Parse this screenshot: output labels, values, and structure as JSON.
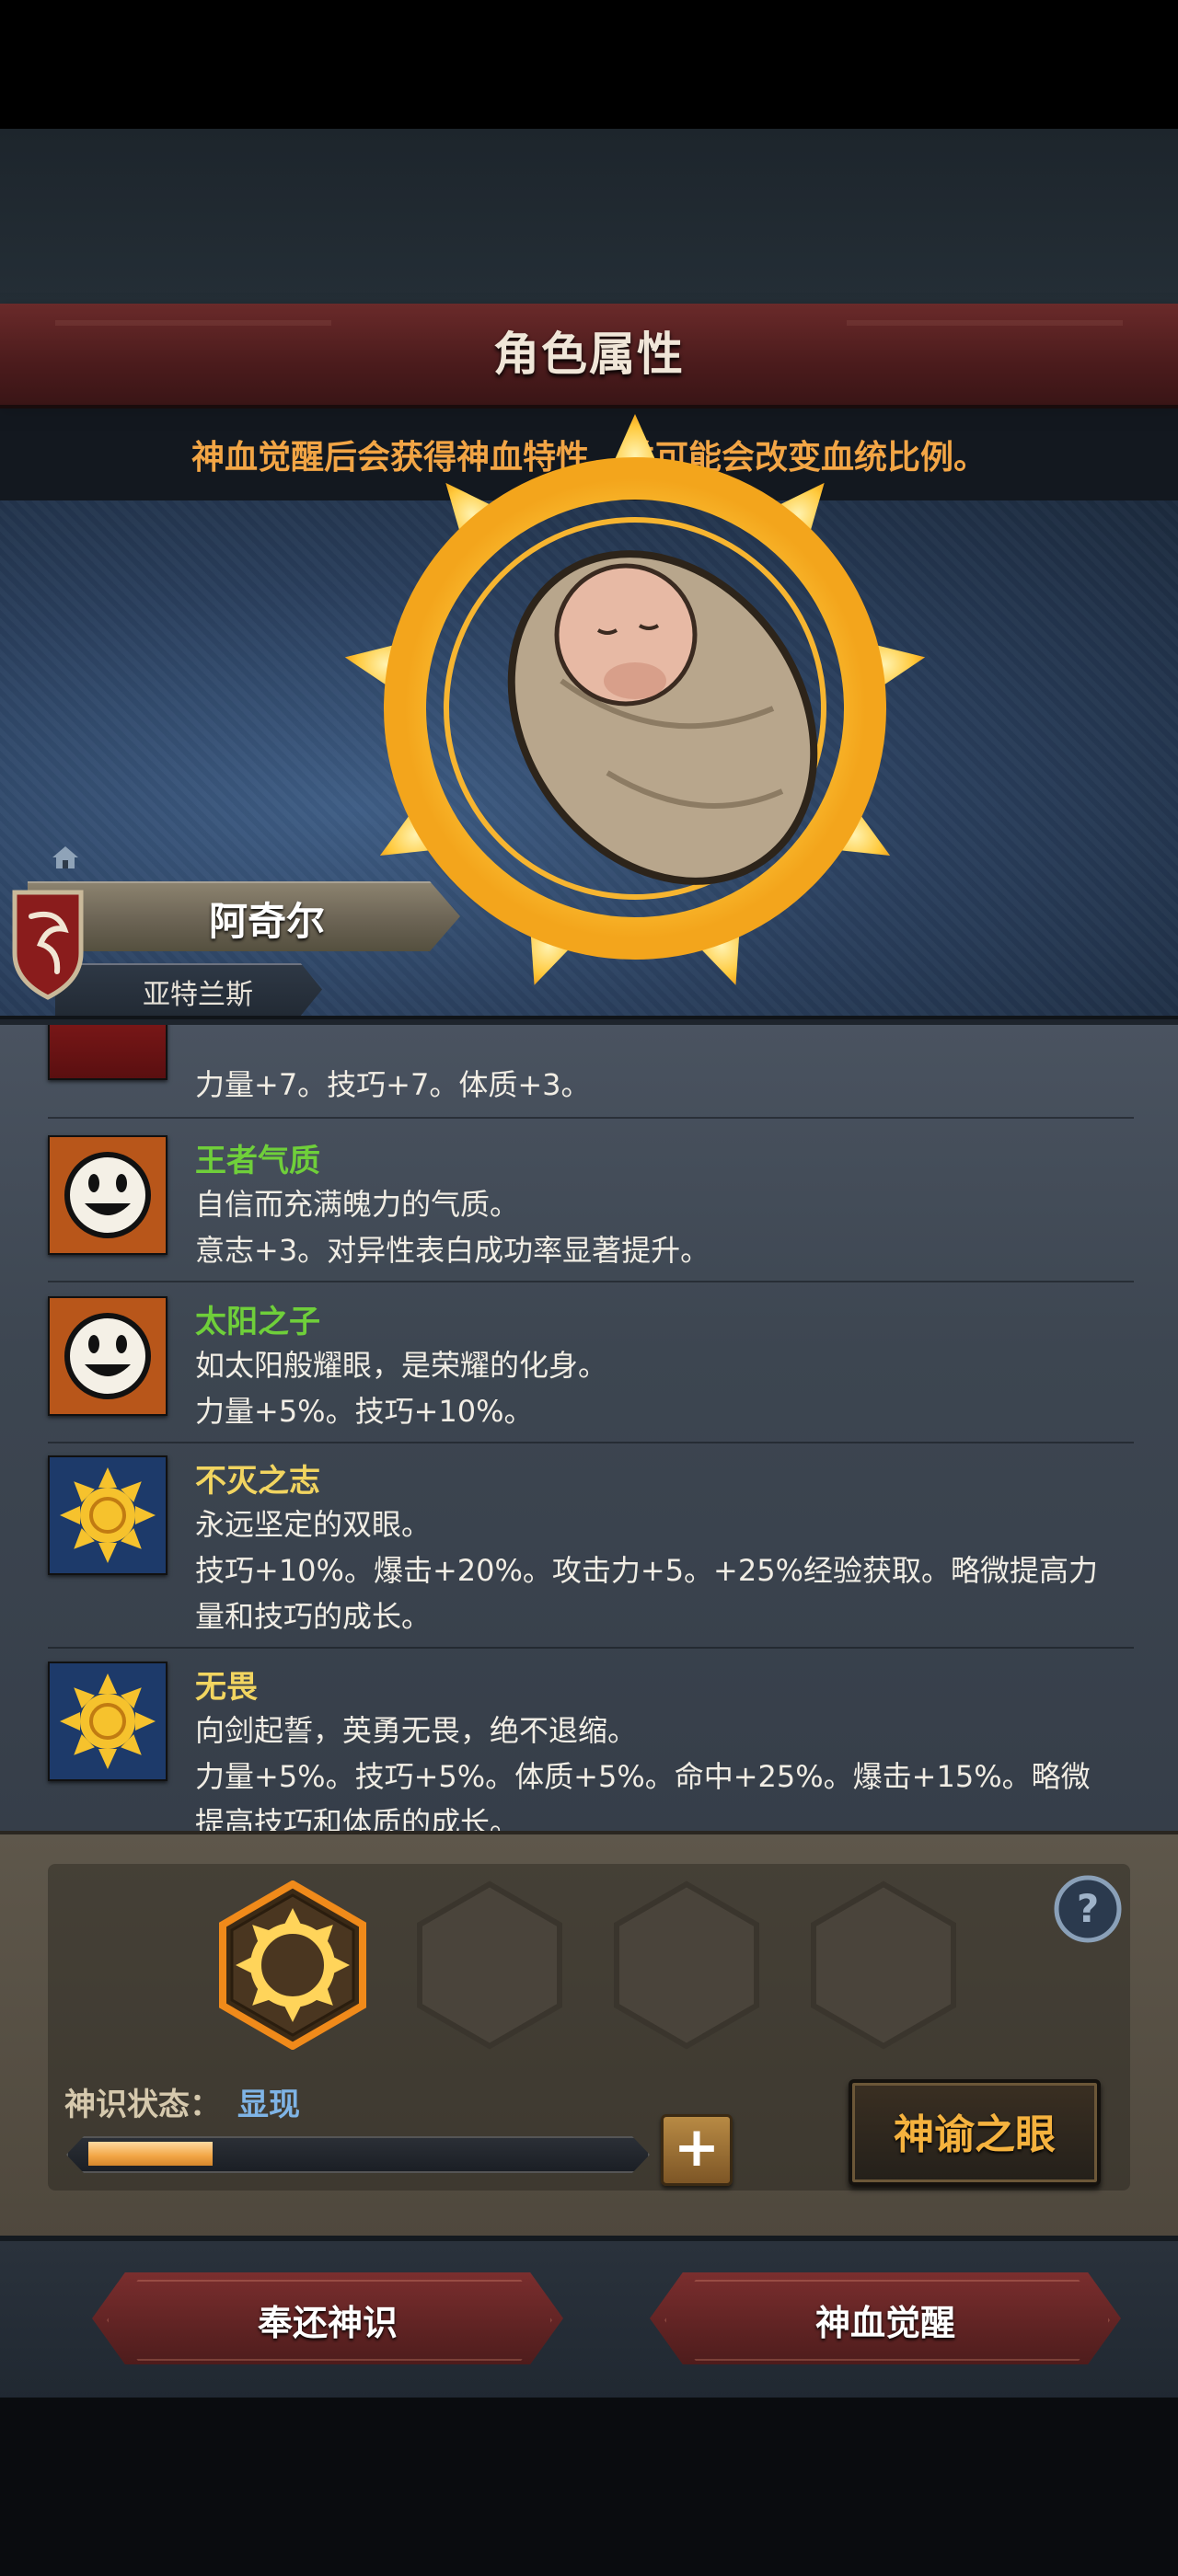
{
  "header": {
    "title": "角色属性",
    "hint": "神血觉醒后会获得神血特性，并可能会改变血统比例。"
  },
  "character": {
    "name": "阿奇尔",
    "origin": "亚特兰斯",
    "portrait_icon": "swaddled-baby-portrait",
    "crest_icon": "red-shield-crest-icon"
  },
  "traits": {
    "partial": {
      "line2": "力量+7。技巧+7。体质+3。",
      "icon": "crimson-emblem-icon"
    },
    "items": [
      {
        "name": "王者气质",
        "name_color": "#6fcf3a",
        "line1": "自信而充满魄力的气质。",
        "line2": "意志+3。对异性表白成功率显著提升。",
        "icon": "smiley-face-icon"
      },
      {
        "name": "太阳之子",
        "name_color": "#6fcf3a",
        "line1": "如太阳般耀眼，是荣耀的化身。",
        "line2": "力量+5%。技巧+10%。",
        "icon": "smiley-face-icon"
      },
      {
        "name": "不灭之志",
        "name_color": "#f2d560",
        "line1": "永远坚定的双眼。",
        "line2": "技巧+10%。爆击+20%。攻击力+5。+25%经验获取。略微提高力",
        "line3": "量和技巧的成长。",
        "icon": "golden-sun-icon"
      },
      {
        "name": "无畏",
        "name_color": "#f2d560",
        "line1": "向剑起誓，英勇无畏，绝不退缩。",
        "line2": "力量+5%。技巧+5%。体质+5%。命中+25%。爆击+15%。略微",
        "line3": "提高技巧和体质的成长。",
        "icon": "golden-sun-icon"
      }
    ]
  },
  "divine_sense": {
    "label": "神识状态：",
    "value": "显现",
    "progress": 0.23,
    "plus_label": "+",
    "oracle_label": "神谕之眼",
    "help_label": "?",
    "slots": [
      "sun-ring-slot",
      "empty-slot",
      "empty-slot",
      "empty-slot"
    ]
  },
  "actions": {
    "return_label": "奉还神识",
    "awaken_label": "神血觉醒"
  },
  "colors": {
    "accent_orange": "#f2a545",
    "title_red": "#5a2324",
    "status_blue": "#7fb4e6"
  }
}
